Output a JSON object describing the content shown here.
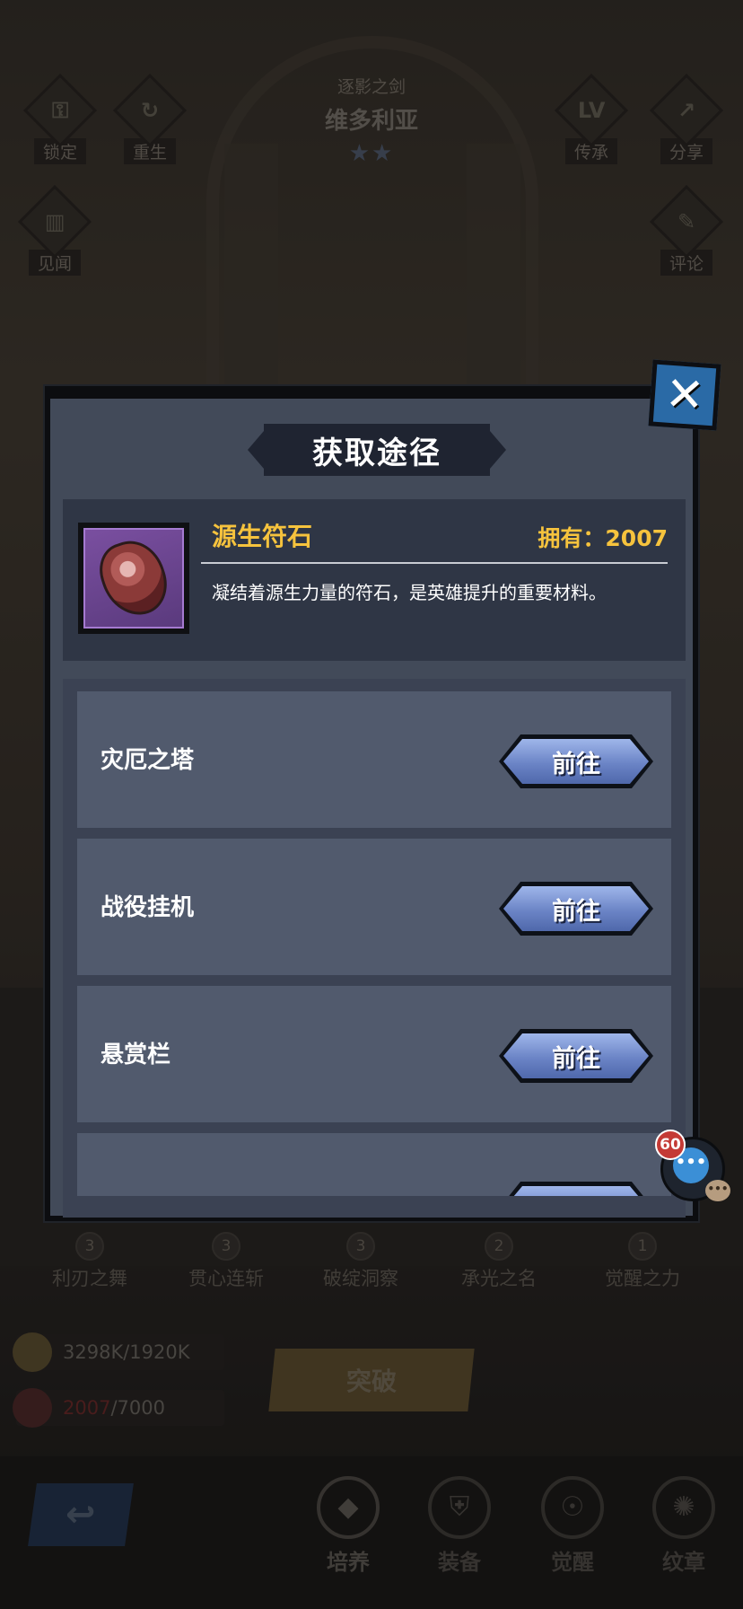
{
  "hero": {
    "subtitle": "逐影之剑",
    "name": "维多利亚",
    "stars": "★★"
  },
  "side_buttons": {
    "lock": {
      "label": "锁定",
      "icon": "lock-icon"
    },
    "rebirth": {
      "label": "重生",
      "icon": "rebirth-icon"
    },
    "lore": {
      "label": "见闻",
      "icon": "book-icon"
    },
    "inherit": {
      "label": "传承",
      "icon": "lv-icon",
      "glyph": "LV"
    },
    "share": {
      "label": "分享",
      "icon": "share-icon"
    },
    "comment": {
      "label": "评论",
      "icon": "comment-icon"
    }
  },
  "skills": [
    {
      "level": "3",
      "name": "利刃之舞"
    },
    {
      "level": "3",
      "name": "贯心连斩"
    },
    {
      "level": "3",
      "name": "破绽洞察"
    },
    {
      "level": "2",
      "name": "承光之名"
    },
    {
      "level": "1",
      "name": "觉醒之力"
    }
  ],
  "resources": {
    "gold": {
      "current": "3298K",
      "required": "/1920K"
    },
    "rune": {
      "current": "2007",
      "required": "/7000"
    }
  },
  "break_button": "突破",
  "bottom_nav": [
    {
      "label": "培养",
      "icon": "train-icon"
    },
    {
      "label": "装备",
      "icon": "equip-icon"
    },
    {
      "label": "觉醒",
      "icon": "awaken-icon"
    },
    {
      "label": "纹章",
      "icon": "emblem-icon"
    }
  ],
  "modal": {
    "title": "获取途径",
    "item": {
      "name": "源生符石",
      "owned": "拥有：2007",
      "description": "凝结着源生力量的符石，是英雄提升的重要材料。",
      "icon": "rune-stone-icon"
    },
    "sources": [
      {
        "name": "灾厄之塔",
        "button": "前往"
      },
      {
        "name": "战役挂机",
        "button": "前往"
      },
      {
        "name": "悬赏栏",
        "button": "前往"
      }
    ]
  },
  "chat": {
    "badge": "60"
  },
  "colors": {
    "accent_gold": "#f6c33d",
    "modal_bg": "#424a59",
    "button_blue": "#6b84c6",
    "close_blue": "#2a6aa6"
  }
}
